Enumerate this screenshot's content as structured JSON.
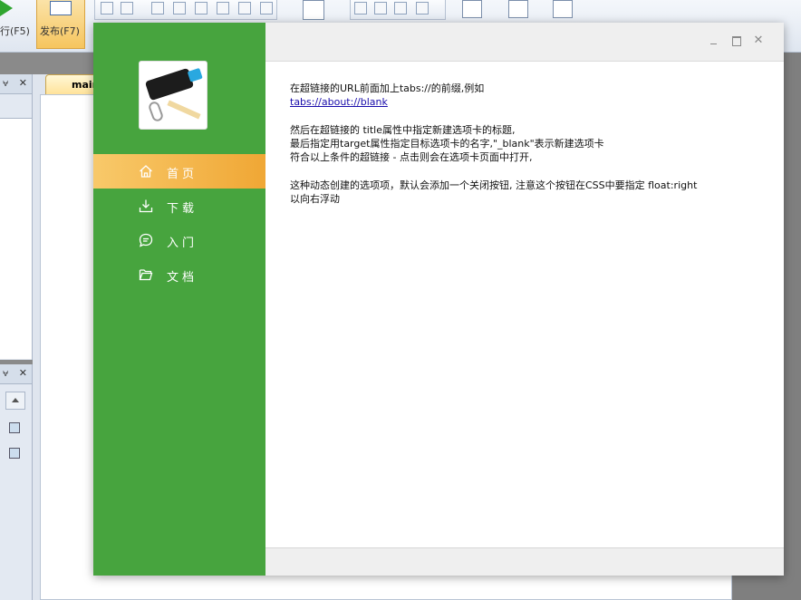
{
  "ide": {
    "run_label": "行(F5)",
    "publish_label": "发布(F7)",
    "doc_tab_label": "main",
    "pin_glyph": "⩝",
    "close_glyph": "✕"
  },
  "window": {
    "buttons": {
      "minimize": "",
      "maximize": "",
      "close": "✕"
    }
  },
  "sidebar": {
    "avatar_alt": "avatar",
    "items": [
      {
        "label": "首页",
        "icon": "home-icon",
        "active": true
      },
      {
        "label": "下载",
        "icon": "download-icon",
        "active": false
      },
      {
        "label": "入门",
        "icon": "chat-icon",
        "active": false
      },
      {
        "label": "文档",
        "icon": "folder-icon",
        "active": false
      }
    ]
  },
  "content": {
    "p1_line1": "在超链接的URL前面加上tabs://的前缀,例如",
    "p1_link": "tabs://about://blank",
    "p2_line1": "然后在超链接的 title属性中指定新建选项卡的标题,",
    "p2_line2": "最后指定用target属性指定目标选项卡的名字,\"_blank\"表示新建选项卡",
    "p2_line3": "符合以上条件的超链接 - 点击则会在选项卡页面中打开,",
    "p3_line1": "这种动态创建的选项项，默认会添加一个关闭按钮, 注意这个按钮在CSS中要指定 float:right",
    "p3_line2": "以向右浮动"
  },
  "colors": {
    "sidebar_green": "#47a43e",
    "active_orange": "#f0a735",
    "link_blue": "#1a0dab"
  }
}
